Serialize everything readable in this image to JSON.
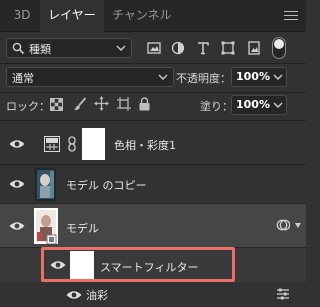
{
  "tabs": [
    {
      "label": "3D"
    },
    {
      "label": "レイヤー"
    },
    {
      "label": "チャンネル"
    }
  ],
  "filter": {
    "kind_label": "種類"
  },
  "blend": {
    "mode": "通常",
    "opacity_label": "不透明度：",
    "opacity_value": "100%"
  },
  "lock": {
    "label": "ロック：",
    "fill_label": "塗り：",
    "fill_value": "100%"
  },
  "layers": [
    {
      "name": "色相・彩度1"
    },
    {
      "name": "モデル のコピー"
    },
    {
      "name": "モデル"
    },
    {
      "name": "スマートフィルター"
    },
    {
      "name": "油彩"
    }
  ],
  "colors": {
    "highlight_box": "#e8706a",
    "selected_row": "#464646",
    "panel_bg": "#323232"
  }
}
